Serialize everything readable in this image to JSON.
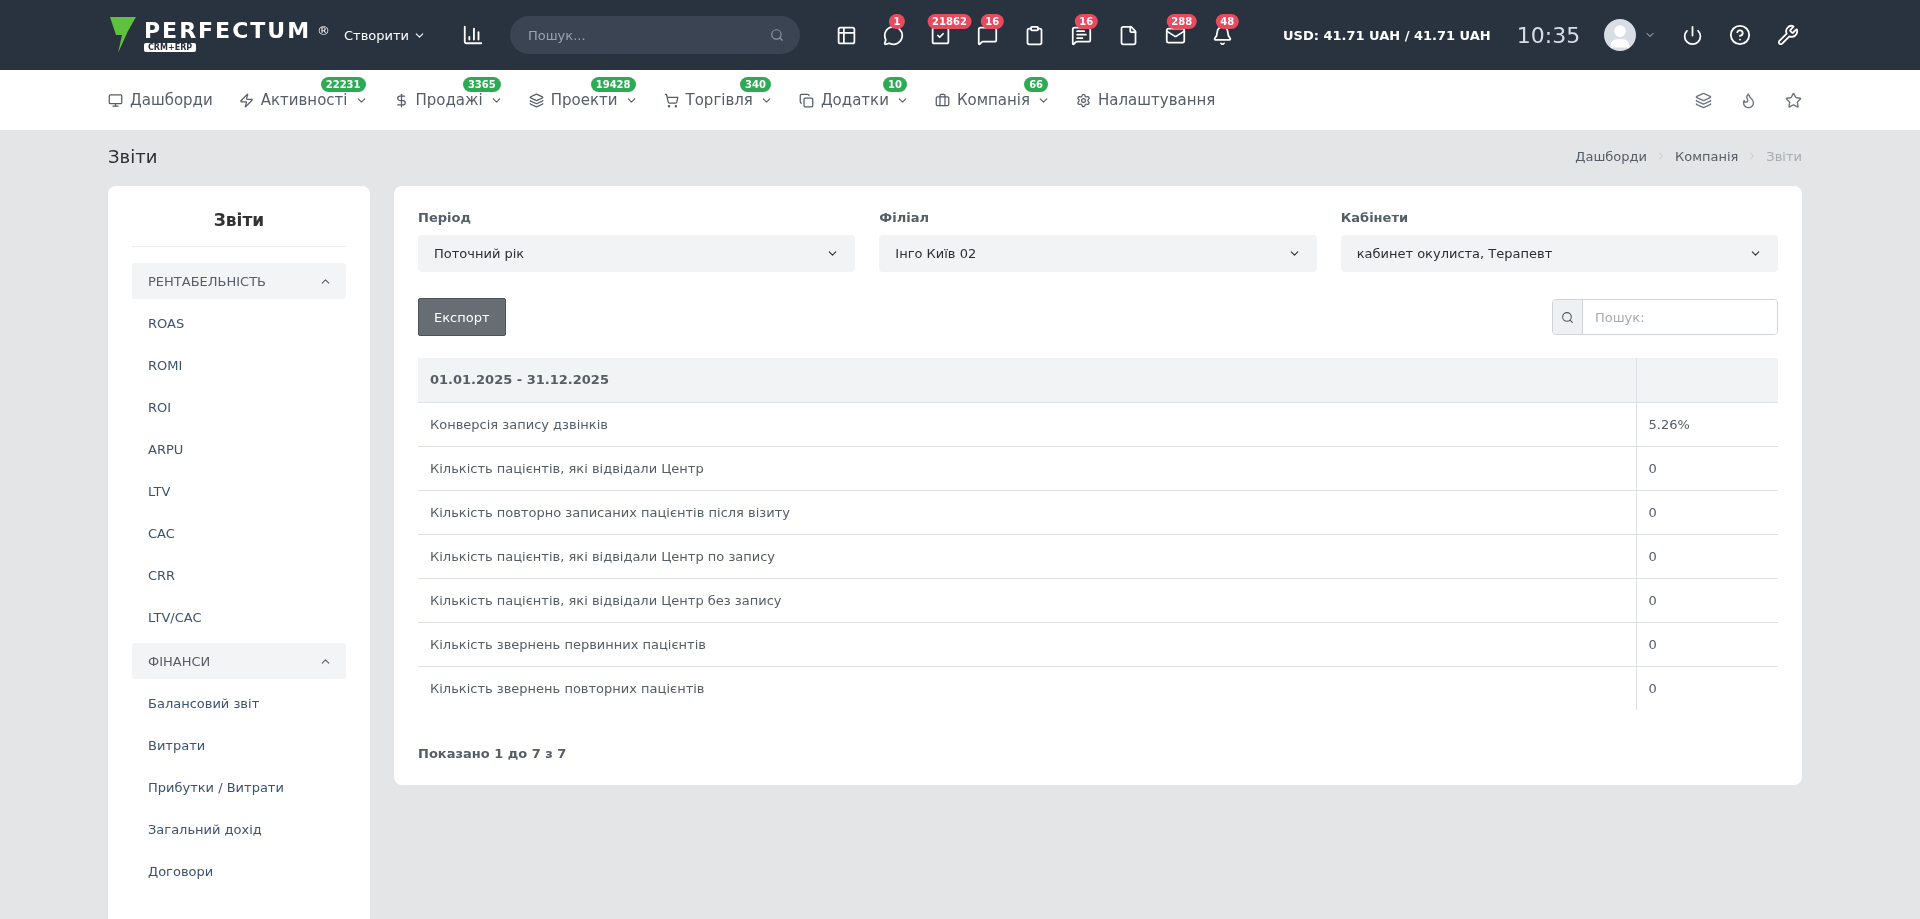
{
  "topbar": {
    "logo_name": "PERFECTUM",
    "logo_mark": "®",
    "logo_sub": "CRM+ERP",
    "create": "Створити",
    "search": {
      "placeholder": "Пошук..."
    },
    "icons": [
      {
        "kind": "table"
      },
      {
        "kind": "chat",
        "badge": "1"
      },
      {
        "kind": "check",
        "badge": "21862"
      },
      {
        "kind": "message",
        "badge": "16"
      },
      {
        "kind": "clipboard"
      },
      {
        "kind": "lines",
        "badge": "16"
      },
      {
        "kind": "file"
      },
      {
        "kind": "mail",
        "badge": "288"
      },
      {
        "kind": "bell",
        "badge": "48"
      }
    ],
    "currency": "USD: 41.71 UAH / 41.71 UAH",
    "time": "10:35"
  },
  "nav": {
    "items": [
      {
        "kind": "monitor",
        "label": "Дашборди",
        "dropdown": false
      },
      {
        "kind": "zap",
        "label": "Активності",
        "badge": "22231",
        "dropdown": true
      },
      {
        "kind": "dollar",
        "label": "Продажі",
        "badge": "3365",
        "dropdown": true
      },
      {
        "kind": "layers",
        "label": "Проекти",
        "badge": "19428",
        "dropdown": true
      },
      {
        "kind": "cart",
        "label": "Торгівля",
        "badge": "340",
        "dropdown": true
      },
      {
        "kind": "copy",
        "label": "Додатки",
        "badge": "10",
        "dropdown": true
      },
      {
        "kind": "briefcase",
        "label": "Компанія",
        "badge": "66",
        "dropdown": true
      },
      {
        "kind": "gear",
        "label": "Налаштування",
        "dropdown": false
      }
    ]
  },
  "page": {
    "title": "Звіти",
    "breadcrumbs": [
      {
        "label": "Дашборди",
        "selected": false
      },
      {
        "label": "Компанія",
        "selected": false
      },
      {
        "label": "Звіти",
        "selected": true
      }
    ]
  },
  "sidebar": {
    "title": "Звіти",
    "sections": [
      {
        "title": "РЕНТАБЕЛЬНІСТЬ",
        "expanded": true,
        "items": [
          "ROAS",
          "ROMI",
          "ROI",
          "ARPU",
          "LTV",
          "CAC",
          "CRR",
          "LTV/CAC"
        ]
      },
      {
        "title": "ФІНАНСИ",
        "expanded": true,
        "items": [
          "Балансовий звіт",
          "Витрати",
          "Прибутки / Витрати",
          "Загальний дохід",
          "Договори"
        ]
      }
    ]
  },
  "filters": [
    {
      "label": "Період",
      "value": "Поточний рік"
    },
    {
      "label": "Філіал",
      "value": "Інго Київ 02"
    },
    {
      "label": "Кабінети",
      "value": "кабинет окулиста, Терапевт"
    }
  ],
  "export_button": "Експорт",
  "table_search": {
    "placeholder": "Пошук:"
  },
  "table": {
    "header": "01.01.2025 - 31.12.2025",
    "rows": [
      [
        "Конверсія запису дзвінків",
        "5.26%"
      ],
      [
        "Кількість пацієнтів, які відвідали Центр",
        "0"
      ],
      [
        "Кількість повторно записаних пацієнтів після візиту",
        "0"
      ],
      [
        "Кількість пацієнтів, які відвідали Центр по запису",
        "0"
      ],
      [
        "Кількість пацієнтів, які відвідали Центр без запису",
        "0"
      ],
      [
        "Кількість звернень первинних пацієнтів",
        "0"
      ],
      [
        "Кількість звернень повторних пацієнтів",
        "0"
      ]
    ]
  },
  "footer": "Показано 1 до 7 з 7"
}
